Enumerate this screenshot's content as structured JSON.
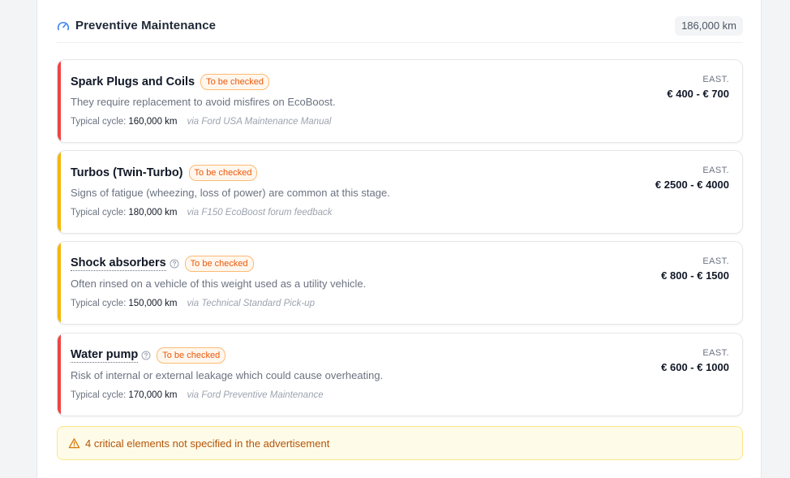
{
  "header": {
    "title": "Preventive Maintenance",
    "mileage": "186,000 km"
  },
  "colors": {
    "accent": "#3b82f6",
    "critical": "#ef4444",
    "warning": "#f5b50a",
    "badge_text": "#ea580c",
    "alert_text": "#b45309"
  },
  "items": [
    {
      "title": "Spark Plugs and Coils",
      "has_help": false,
      "status": "To be checked",
      "description": "They require replacement to avoid misfires on EcoBoost.",
      "cycle_label": "Typical cycle:",
      "cycle_value": "160,000 km",
      "source": "via Ford USA Maintenance Manual",
      "est_label": "EAST.",
      "price": "€ 400 - € 700",
      "severity": "critical"
    },
    {
      "title": "Turbos (Twin-Turbo)",
      "has_help": false,
      "status": "To be checked",
      "description": "Signs of fatigue (wheezing, loss of power) are common at this stage.",
      "cycle_label": "Typical cycle:",
      "cycle_value": "180,000 km",
      "source": "via F150 EcoBoost forum feedback",
      "est_label": "EAST.",
      "price": "€ 2500 - € 4000",
      "severity": "warning"
    },
    {
      "title": "Shock absorbers",
      "has_help": true,
      "status": "To be checked",
      "description": "Often rinsed on a vehicle of this weight used as a utility vehicle.",
      "cycle_label": "Typical cycle:",
      "cycle_value": "150,000 km",
      "source": "via Technical Standard Pick-up",
      "est_label": "EAST.",
      "price": "€ 800 - € 1500",
      "severity": "warning"
    },
    {
      "title": "Water pump",
      "has_help": true,
      "status": "To be checked",
      "description": "Risk of internal or external leakage which could cause overheating.",
      "cycle_label": "Typical cycle:",
      "cycle_value": "170,000 km",
      "source": "via Ford Preventive Maintenance",
      "est_label": "EAST.",
      "price": "€ 600 - € 1000",
      "severity": "critical"
    }
  ],
  "alert": {
    "icon": "warning-triangle-icon",
    "text": "4 critical elements not specified in the advertisement"
  }
}
